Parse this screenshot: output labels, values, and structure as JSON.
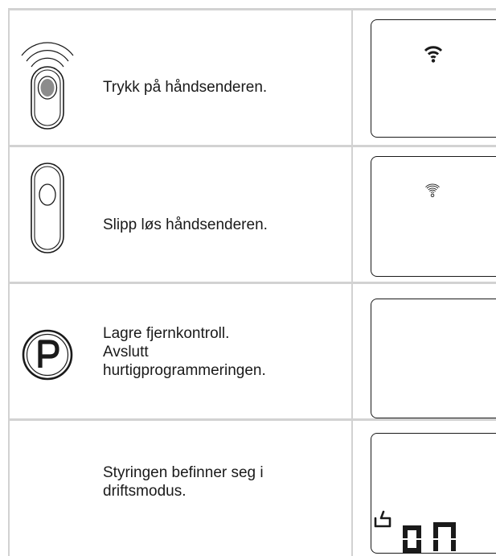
{
  "rows": [
    {
      "instruction": [
        "Trykk på håndsenderen."
      ],
      "remote_icon": "remote-button-pressed-icon",
      "display_icon": "signal-strong-icon"
    },
    {
      "instruction": [
        "Slipp løs håndsenderen."
      ],
      "remote_icon": "remote-button-released-icon",
      "display_icon": "signal-outline-icon"
    },
    {
      "instruction": [
        "Lagre fjernkontroll.",
        "Avslutt",
        "hurtigprogrammeringen."
      ],
      "remote_icon": "p-button-icon",
      "display_icon": ""
    },
    {
      "instruction": [
        "Styringen befinner seg i",
        "driftsmodus."
      ],
      "remote_icon": "",
      "display_icon": "hand-icon",
      "display_text": "on"
    }
  ],
  "colors": {
    "grid_line": "#d2d2d2",
    "ink": "#1a1a1a",
    "button_fill": "#8c8c8c"
  }
}
